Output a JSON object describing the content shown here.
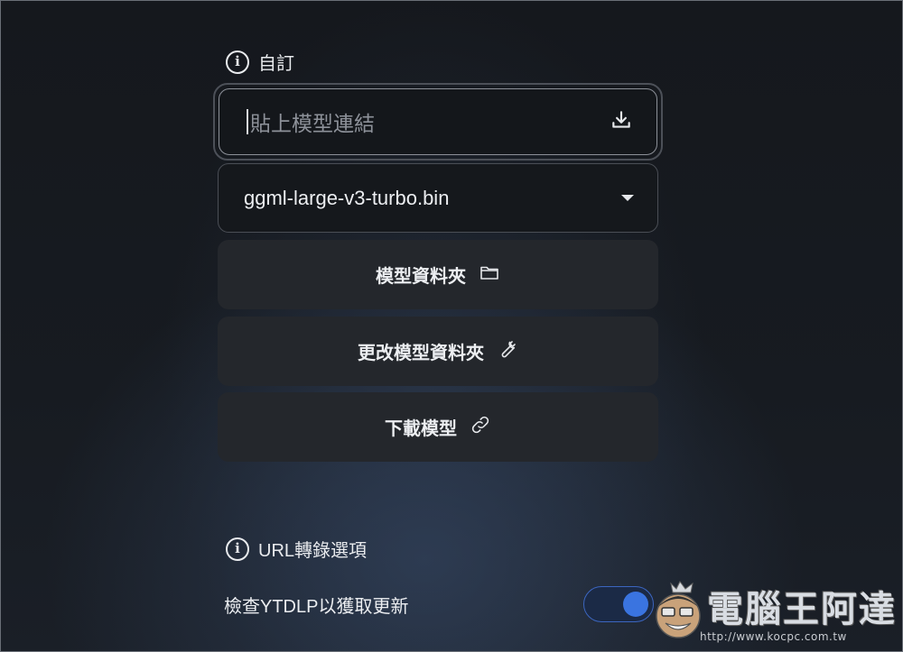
{
  "custom_section": {
    "title": "自訂",
    "icon": "info-icon"
  },
  "model_link_input": {
    "placeholder": "貼上模型連結",
    "icon": "download-icon"
  },
  "model_select": {
    "selected": "ggml-large-v3-turbo.bin"
  },
  "buttons": {
    "model_folder": "模型資料夾",
    "change_model_folder": "更改模型資料夾",
    "download_model": "下載模型"
  },
  "url_section": {
    "title": "URL轉錄選項",
    "icon": "info-icon"
  },
  "ytdlp_toggle": {
    "label": "檢查YTDLP以獲取更新",
    "state": "on",
    "accent_color": "#3a74e0"
  },
  "watermark": {
    "text": "電腦王阿達",
    "url": "http://www.kocpc.com.tw"
  }
}
